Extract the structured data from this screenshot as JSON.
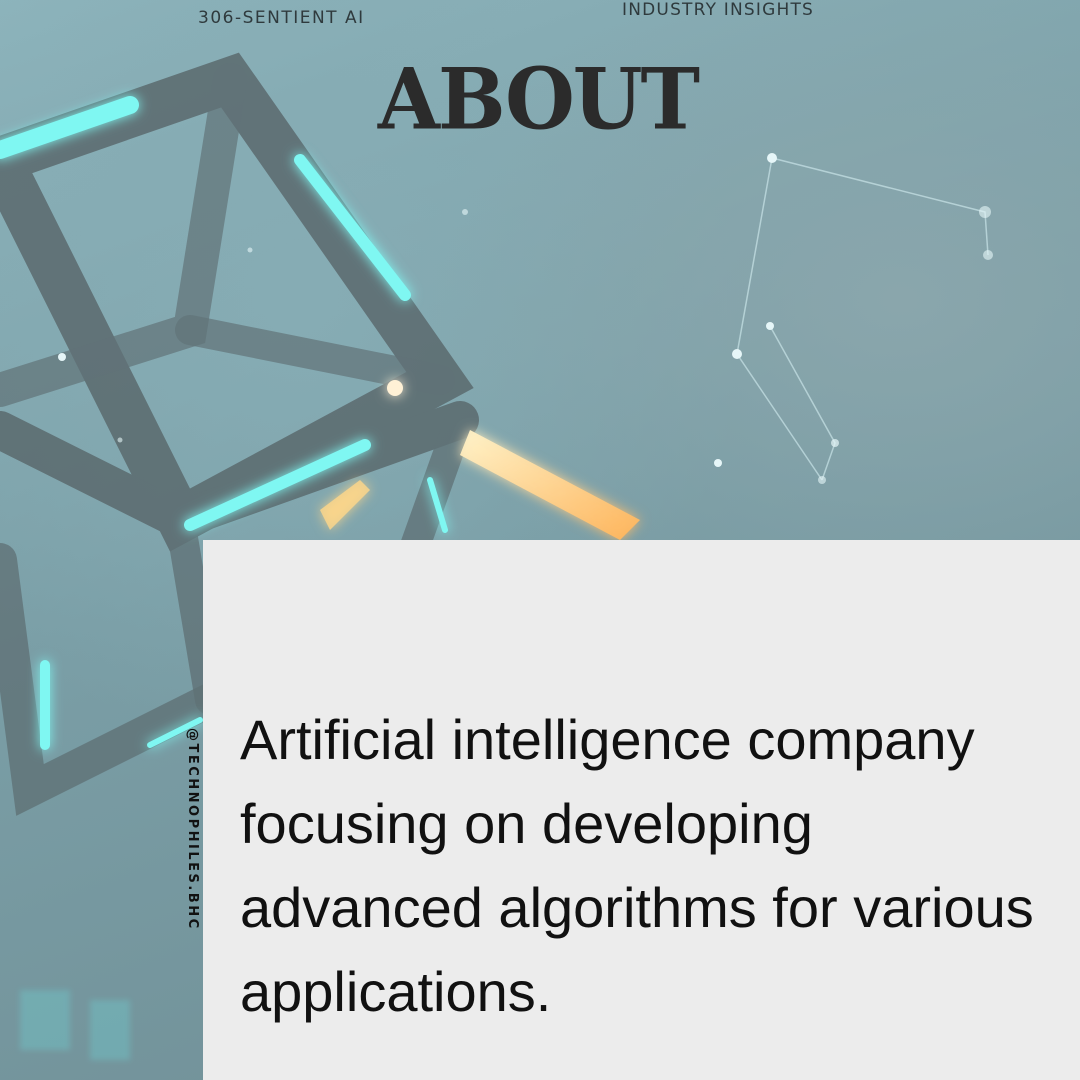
{
  "header": {
    "brand": "306-SENTIENT AI",
    "category": "INDUSTRY INSIGHTS",
    "title": "ABOUT"
  },
  "card": {
    "description": "Artificial intelligence company focusing on developing advanced algorithms for various applications."
  },
  "social": {
    "handle": "@TECHNOPHILES.BHC"
  },
  "colors": {
    "background_teal": "#7fa3ab",
    "card": "#ececec",
    "text_dark": "#111111",
    "glow_cyan": "#6ff5f0",
    "glow_orange": "#ffd27a"
  }
}
